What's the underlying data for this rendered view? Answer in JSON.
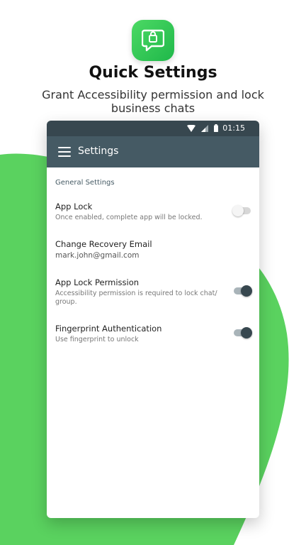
{
  "hero": {
    "title": "Quick Settings",
    "subtitle": "Grant Accessibility permission and lock business chats",
    "icon": "chat-lock-app-icon"
  },
  "statusbar": {
    "time": "01:15",
    "icons": [
      "wifi-icon",
      "signal-icon",
      "battery-icon"
    ]
  },
  "toolbar": {
    "title": "Settings",
    "menu_icon": "hamburger-menu-icon"
  },
  "settings": {
    "section_header": "General Settings",
    "items": [
      {
        "title": "App Lock",
        "subtitle": "Once enabled, complete app will be locked.",
        "toggle": "off"
      },
      {
        "title": "Change Recovery Email",
        "value": "mark.john@gmail.com"
      },
      {
        "title": "App Lock Permission",
        "subtitle": "Accessibility permission is required to lock chat/ group.",
        "toggle": "on"
      },
      {
        "title": "Fingerprint Authentication",
        "subtitle": "Use fingerprint to unlock",
        "toggle": "on"
      }
    ]
  },
  "colors": {
    "accent_green": "#4cd964",
    "toolbar": "#455a64",
    "statusbar": "#37474f"
  }
}
